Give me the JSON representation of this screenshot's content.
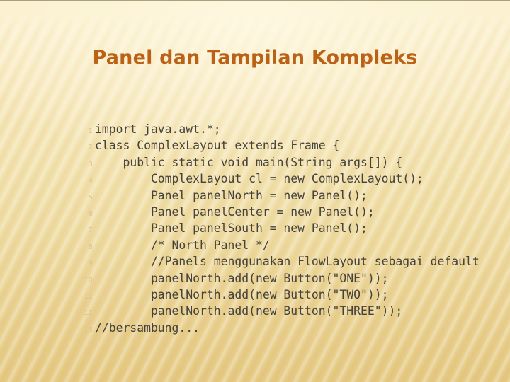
{
  "slide": {
    "title": "Panel dan Tampilan Kompleks",
    "title_color": "#bb6217",
    "background_top_color": "#fbf0cd",
    "background_bottom_color": "#e5c982",
    "code_text_color": "#46423b",
    "line_number_color": "#d8c290"
  },
  "code": {
    "language": "java",
    "lines": [
      {
        "n": "1",
        "text": "import java.awt.*;"
      },
      {
        "n": "2",
        "text": "class ComplexLayout extends Frame {"
      },
      {
        "n": "3",
        "text": "    public static void main(String args[]) {"
      },
      {
        "n": "4",
        "text": "        ComplexLayout cl = new ComplexLayout();"
      },
      {
        "n": "5",
        "text": "        Panel panelNorth = new Panel();"
      },
      {
        "n": "6",
        "text": "        Panel panelCenter = new Panel();"
      },
      {
        "n": "7",
        "text": "        Panel panelSouth = new Panel();"
      },
      {
        "n": "8",
        "text": "        /* North Panel */"
      },
      {
        "n": "9",
        "text": "        //Panels menggunakan FlowLayout sebagai default"
      },
      {
        "n": "10",
        "text": "        panelNorth.add(new Button(\"ONE\"));"
      },
      {
        "n": "11",
        "text": "        panelNorth.add(new Button(\"TWO\"));"
      },
      {
        "n": "12",
        "text": "        panelNorth.add(new Button(\"THREE\"));"
      },
      {
        "n": "13",
        "text": "//bersambung..."
      }
    ]
  }
}
